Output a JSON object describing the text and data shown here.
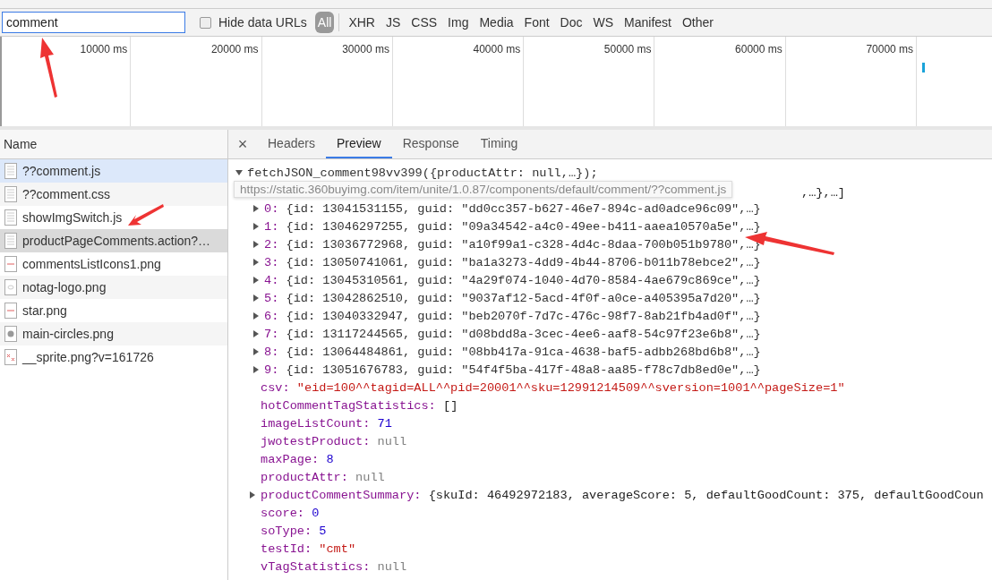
{
  "filter": {
    "value": "comment"
  },
  "hide_data_urls": {
    "label": "Hide data URLs",
    "checked": false
  },
  "type_filters": [
    {
      "label": "All",
      "selected": true
    },
    {
      "label": "XHR",
      "selected": false
    },
    {
      "label": "JS",
      "selected": false
    },
    {
      "label": "CSS",
      "selected": false
    },
    {
      "label": "Img",
      "selected": false
    },
    {
      "label": "Media",
      "selected": false
    },
    {
      "label": "Font",
      "selected": false
    },
    {
      "label": "Doc",
      "selected": false
    },
    {
      "label": "WS",
      "selected": false
    },
    {
      "label": "Manifest",
      "selected": false
    },
    {
      "label": "Other",
      "selected": false
    }
  ],
  "timeline": {
    "ticks": [
      "10000 ms",
      "20000 ms",
      "30000 ms",
      "40000 ms",
      "50000 ms",
      "60000 ms",
      "70000 ms"
    ]
  },
  "requests_header": "Name",
  "requests": [
    {
      "name": "??comment.js",
      "kind": "file",
      "selected": false,
      "hovered": true
    },
    {
      "name": "??comment.css",
      "kind": "file",
      "selected": false,
      "hovered": false
    },
    {
      "name": "showImgSwitch.js",
      "kind": "file",
      "selected": false,
      "hovered": false
    },
    {
      "name": "productPageComments.action?…",
      "kind": "file",
      "selected": true,
      "hovered": false
    },
    {
      "name": "commentsListIcons1.png",
      "kind": "image",
      "selected": false,
      "hovered": false
    },
    {
      "name": "notag-logo.png",
      "kind": "logo",
      "selected": false,
      "hovered": false
    },
    {
      "name": "star.png",
      "kind": "image",
      "selected": false,
      "hovered": false
    },
    {
      "name": "main-circles.png",
      "kind": "circle",
      "selected": false,
      "hovered": false
    },
    {
      "name": "__sprite.png?v=161726",
      "kind": "sprite",
      "selected": false,
      "hovered": false
    }
  ],
  "detail": {
    "close": "×",
    "tabs": [
      {
        "label": "Headers",
        "selected": false
      },
      {
        "label": "Preview",
        "selected": true
      },
      {
        "label": "Response",
        "selected": false
      },
      {
        "label": "Timing",
        "selected": false
      }
    ],
    "root": {
      "text": "fetchJSON_comment98vv399({productAttr: null,…});",
      "expanded": true
    },
    "tooltip": "https://static.360buyimg.com/item/unite/1.0.87/components/default/comment/??comment.js",
    "covered_tail": ",…},…]",
    "items": [
      {
        "index": "0:",
        "text": "{id: 13041531155, guid: \"dd0cc357-b627-46e7-894c-ad0adce96c09\",…}"
      },
      {
        "index": "1:",
        "text": "{id: 13046297255, guid: \"09a34542-a4c0-49ee-b411-aaea10570a5e\",…}"
      },
      {
        "index": "2:",
        "text": "{id: 13036772968, guid: \"a10f99a1-c328-4d4c-8daa-700b051b9780\",…}"
      },
      {
        "index": "3:",
        "text": "{id: 13050741061, guid: \"ba1a3273-4dd9-4b44-8706-b011b78ebce2\",…}"
      },
      {
        "index": "4:",
        "text": "{id: 13045310561, guid: \"4a29f074-1040-4d70-8584-4ae679c869ce\",…}"
      },
      {
        "index": "5:",
        "text": "{id: 13042862510, guid: \"9037af12-5acd-4f0f-a0ce-a405395a7d20\",…}"
      },
      {
        "index": "6:",
        "text": "{id: 13040332947, guid: \"beb2070f-7d7c-476c-98f7-8ab21fb4ad0f\",…}"
      },
      {
        "index": "7:",
        "text": "{id: 13117244565, guid: \"d08bdd8a-3cec-4ee6-aaf8-54c97f23e6b8\",…}"
      },
      {
        "index": "8:",
        "text": "{id: 13064484861, guid: \"08bb417a-91ca-4638-baf5-adbb268bd6b8\",…}"
      },
      {
        "index": "9:",
        "text": "{id: 13051676783, guid: \"54f4f5ba-417f-48a8-aa85-f78c7db8ed0e\",…}"
      }
    ],
    "properties": [
      {
        "key": "csv:",
        "value": "\"eid=100^^tagid=ALL^^pid=20001^^sku=12991214509^^sversion=1001^^pageSize=1\"",
        "kind": "string",
        "expandable": false
      },
      {
        "key": "hotCommentTagStatistics:",
        "value": "[]",
        "kind": "plain",
        "expandable": false
      },
      {
        "key": "imageListCount:",
        "value": "71",
        "kind": "number",
        "expandable": false
      },
      {
        "key": "jwotestProduct:",
        "value": "null",
        "kind": "null",
        "expandable": false
      },
      {
        "key": "maxPage:",
        "value": "8",
        "kind": "number",
        "expandable": false
      },
      {
        "key": "productAttr:",
        "value": "null",
        "kind": "null",
        "expandable": false
      },
      {
        "key": "productCommentSummary:",
        "value": "{skuId: 46492972183, averageScore: 5, defaultGoodCount: 375, defaultGoodCoun",
        "kind": "plain",
        "expandable": true
      },
      {
        "key": "score:",
        "value": "0",
        "kind": "number",
        "expandable": false
      },
      {
        "key": "soType:",
        "value": "5",
        "kind": "number",
        "expandable": false
      },
      {
        "key": "testId:",
        "value": "\"cmt\"",
        "kind": "string",
        "expandable": false
      },
      {
        "key": "vTagStatistics:",
        "value": "null",
        "kind": "null",
        "expandable": false
      }
    ]
  }
}
